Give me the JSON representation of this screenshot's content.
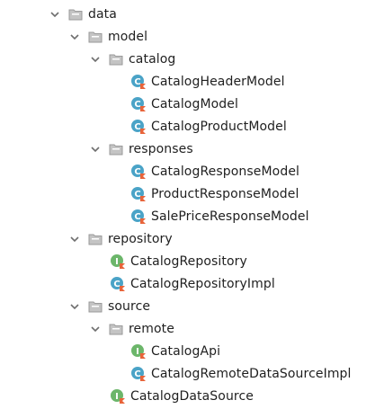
{
  "tree": {
    "data": {
      "label": "data"
    },
    "model": {
      "label": "model"
    },
    "catalog": {
      "label": "catalog"
    },
    "catalog_header_model": {
      "label": "CatalogHeaderModel"
    },
    "catalog_model": {
      "label": "CatalogModel"
    },
    "catalog_product_model": {
      "label": "CatalogProductModel"
    },
    "responses": {
      "label": "responses"
    },
    "catalog_response_model": {
      "label": "CatalogResponseModel"
    },
    "product_response_model": {
      "label": "ProductResponseModel"
    },
    "sale_price_response_model": {
      "label": "SalePriceResponseModel"
    },
    "repository": {
      "label": "repository"
    },
    "catalog_repository": {
      "label": "CatalogRepository"
    },
    "catalog_repository_impl": {
      "label": "CatalogRepositoryImpl"
    },
    "source": {
      "label": "source"
    },
    "remote": {
      "label": "remote"
    },
    "catalog_api": {
      "label": "CatalogApi"
    },
    "catalog_remote_data_source_impl": {
      "label": "CatalogRemoteDataSourceImpl"
    },
    "catalog_data_source": {
      "label": "CatalogDataSource"
    }
  },
  "colors": {
    "class_icon": "#4aa3c7",
    "interface_icon": "#6cb66a",
    "kotlin_badge": "#e8643a",
    "folder": "#b9b9b9",
    "chevron": "#6e6e6e",
    "text": "#1f1f1f"
  }
}
